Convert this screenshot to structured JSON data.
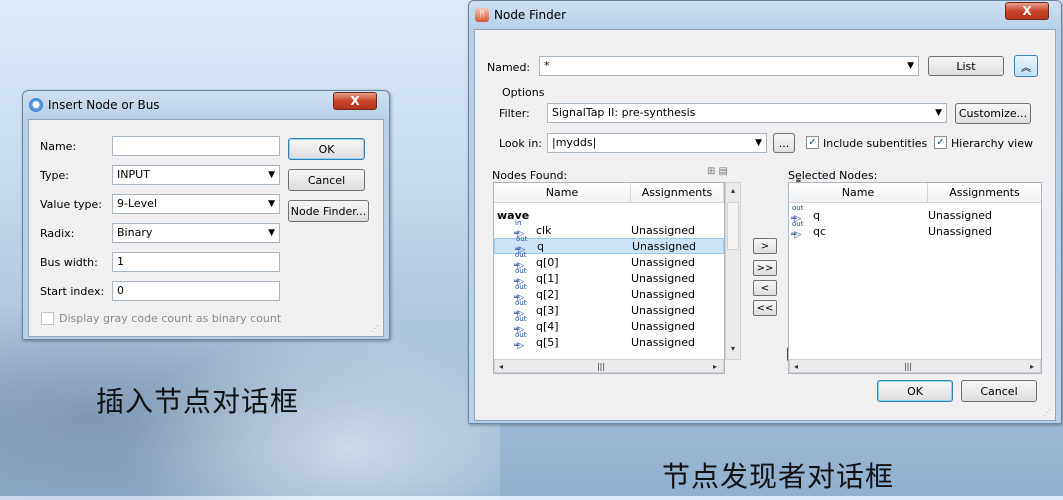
{
  "captions": {
    "insert": "插入节点对话框",
    "finder": "节点发现者对话框"
  },
  "insert": {
    "title": "Insert Node or Bus",
    "close": "X",
    "name_label": "Name:",
    "name_value": "",
    "type_label": "Type:",
    "type_value": "INPUT",
    "value_type_label": "Value type:",
    "value_type_value": "9-Level",
    "radix_label": "Radix:",
    "radix_value": "Binary",
    "bus_width_label": "Bus width:",
    "bus_width_value": "1",
    "start_index_label": "Start index:",
    "start_index_value": "0",
    "gray_label": "Display gray code count as binary count",
    "ok": "OK",
    "cancel": "Cancel",
    "node_finder": "Node Finder..."
  },
  "finder": {
    "title": "Node Finder",
    "close": "X",
    "named_label": "Named:",
    "named_value": "*",
    "list_btn": "List",
    "options_label": "Options",
    "filter_label": "Filter:",
    "filter_value": "SignalTap II: pre-synthesis",
    "customize": "Customize...",
    "look_in_label": "Look in:",
    "look_in_value": "|mydds|",
    "browse": "...",
    "include_sub": "Include subentities",
    "hierarchy_view": "Hierarchy view",
    "nodes_found": "Nodes Found:",
    "selected_nodes": "Selected Nodes:",
    "col_name": "Name",
    "col_assign": "Assignments",
    "group": "wave",
    "found": [
      {
        "dir": "in",
        "name": "clk",
        "assign": "Unassigned"
      },
      {
        "dir": "out",
        "name": "q",
        "assign": "Unassigned",
        "selected": true
      },
      {
        "dir": "out",
        "name": "q[0]",
        "assign": "Unassigned"
      },
      {
        "dir": "out",
        "name": "q[1]",
        "assign": "Unassigned"
      },
      {
        "dir": "out",
        "name": "q[2]",
        "assign": "Unassigned"
      },
      {
        "dir": "out",
        "name": "q[3]",
        "assign": "Unassigned"
      },
      {
        "dir": "out",
        "name": "q[4]",
        "assign": "Unassigned"
      },
      {
        "dir": "out",
        "name": "q[5]",
        "assign": "Unassigned"
      }
    ],
    "selected": [
      {
        "dir": "out",
        "name": "q",
        "assign": "Unassigned"
      },
      {
        "dir": "out",
        "name": "qc",
        "assign": "Unassigned"
      }
    ],
    "move": [
      ">",
      ">>",
      "<",
      "<<"
    ],
    "ok": "OK",
    "cancel": "Cancel"
  }
}
